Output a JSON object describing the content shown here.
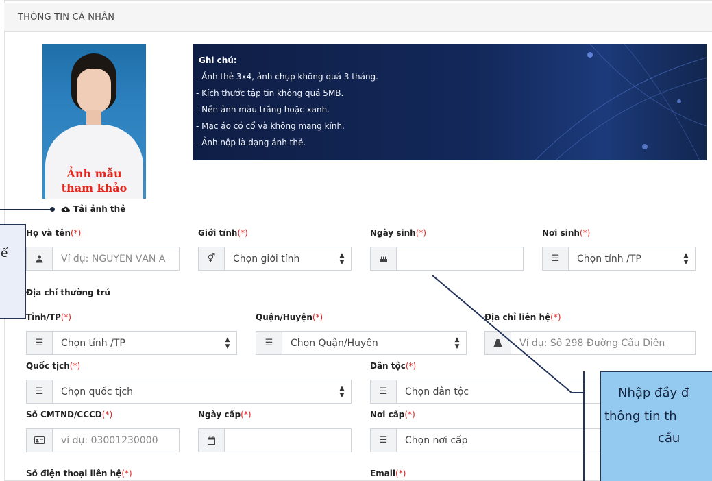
{
  "header": {
    "title": "THÔNG TIN CÁ NHÂN"
  },
  "photo": {
    "caption_line1": "Ảnh mẫu",
    "caption_line2": "tham khảo"
  },
  "upload": {
    "label": "Tải ảnh thẻ",
    "icon": "cloud-upload-icon"
  },
  "note": {
    "title": "Ghi chú:",
    "items": [
      "- Ảnh thẻ 3x4, ảnh chụp không quá 3 tháng.",
      "- Kích thước tập tin không quá 5MB.",
      "- Nền ảnh màu trắng hoặc xanh.",
      "- Mặc áo có cổ và không mang kính.",
      "- Ảnh nộp là dạng ảnh thẻ."
    ]
  },
  "required_mark": "(*)",
  "form": {
    "full_name": {
      "label": "Họ và tên",
      "placeholder": "Ví dụ: NGUYỄN VĂN A",
      "icon": "user-icon"
    },
    "gender": {
      "label": "Giới tính",
      "value": "Chọn giới tính",
      "icon": "gender-icon"
    },
    "birthdate": {
      "label": "Ngày sinh",
      "value": "",
      "icon": "cake-icon"
    },
    "birthplace": {
      "label": "Nơi sinh",
      "value": "Chọn tỉnh /TP",
      "icon": "list-icon"
    },
    "address_section": "Địa chỉ thường trú",
    "province": {
      "label": "Tỉnh/TP",
      "value": "Chọn tỉnh /TP",
      "icon": "list-icon"
    },
    "district": {
      "label": "Quận/Huyện",
      "value": "Chọn Quận/Huyện",
      "icon": "list-icon"
    },
    "contact_address": {
      "label": "Địa chỉ liên hệ",
      "placeholder": "Ví dụ: Số 298 Đường Cầu Diễn",
      "icon": "road-icon"
    },
    "nationality": {
      "label": "Quốc tịch",
      "value": "Chọn quốc tịch",
      "icon": "list-icon"
    },
    "ethnicity": {
      "label": "Dân tộc",
      "value": "Chọn dân tộc",
      "icon": "list-icon"
    },
    "id_number": {
      "label": "Số CMTND/CCCD",
      "placeholder": "ví dụ: 03001230000",
      "icon": "id-card-icon"
    },
    "issue_date": {
      "label": "Ngày cấp",
      "value": "",
      "icon": "calendar-icon"
    },
    "issue_place": {
      "label": "Nơi cấp",
      "value": "Chọn nơi cấp",
      "icon": "list-icon"
    },
    "phone": {
      "label": "Số điện thoại liên hệ"
    },
    "email": {
      "label": "Email"
    }
  },
  "callout_left": {
    "text": "ể"
  },
  "callout_right": {
    "line1": "Nhập đầy đ",
    "line2": "thông tin th",
    "line3": "cầu"
  },
  "colors": {
    "required": "#e02424",
    "banner": "#13285a",
    "callout": "#94caf0",
    "photo_caption": "#e8251d"
  }
}
